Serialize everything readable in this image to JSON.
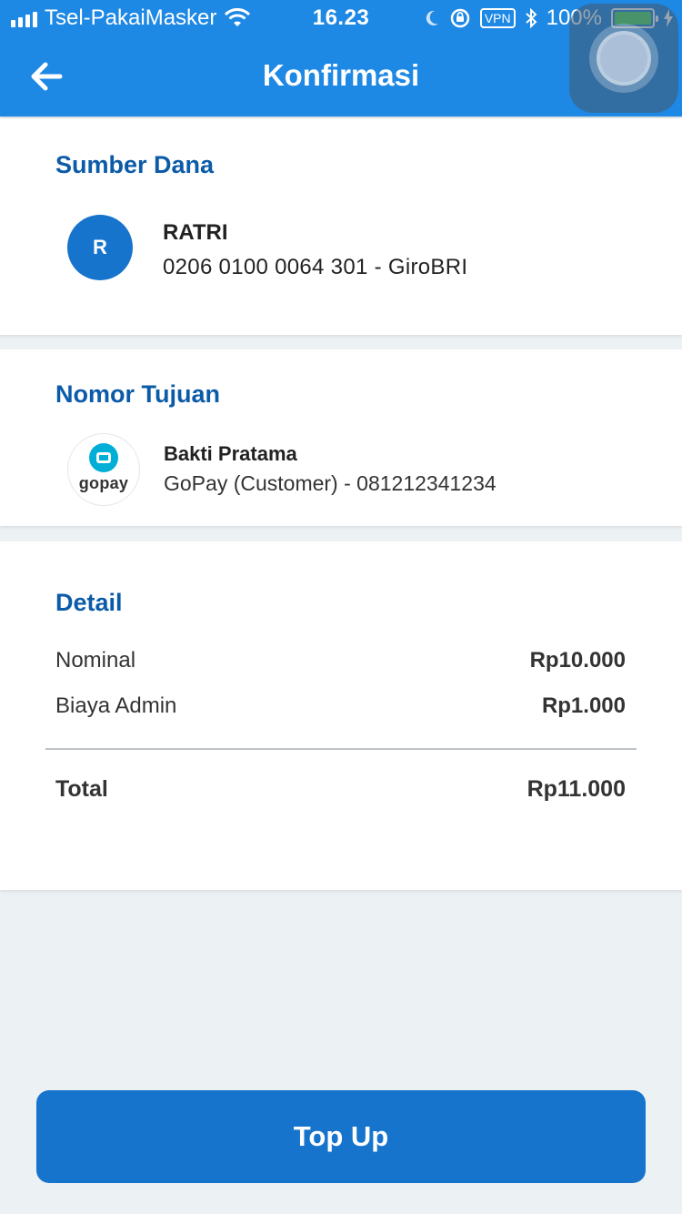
{
  "status_bar": {
    "carrier": "Tsel-PakaiMasker",
    "time": "16.23",
    "vpn": "VPN",
    "battery": "100%"
  },
  "header": {
    "title": "Konfirmasi"
  },
  "source": {
    "title": "Sumber Dana",
    "initial": "R",
    "name": "RATRI",
    "account": "0206 0100 0064 301 - GiroBRI"
  },
  "destination": {
    "title": "Nomor Tujuan",
    "logo_text": "gopay",
    "name": "Bakti Pratama",
    "detail": "GoPay (Customer) - 081212341234"
  },
  "detail": {
    "title": "Detail",
    "rows": [
      {
        "label": "Nominal",
        "value": "Rp10.000"
      },
      {
        "label": "Biaya Admin",
        "value": "Rp1.000"
      }
    ],
    "total_label": "Total",
    "total_value": "Rp11.000"
  },
  "cta": {
    "label": "Top Up"
  },
  "colors": {
    "primary": "#1E88E5",
    "heading": "#0B5BA8",
    "button": "#1774CC",
    "gopay": "#00AED6",
    "background": "#ECF1F4"
  }
}
